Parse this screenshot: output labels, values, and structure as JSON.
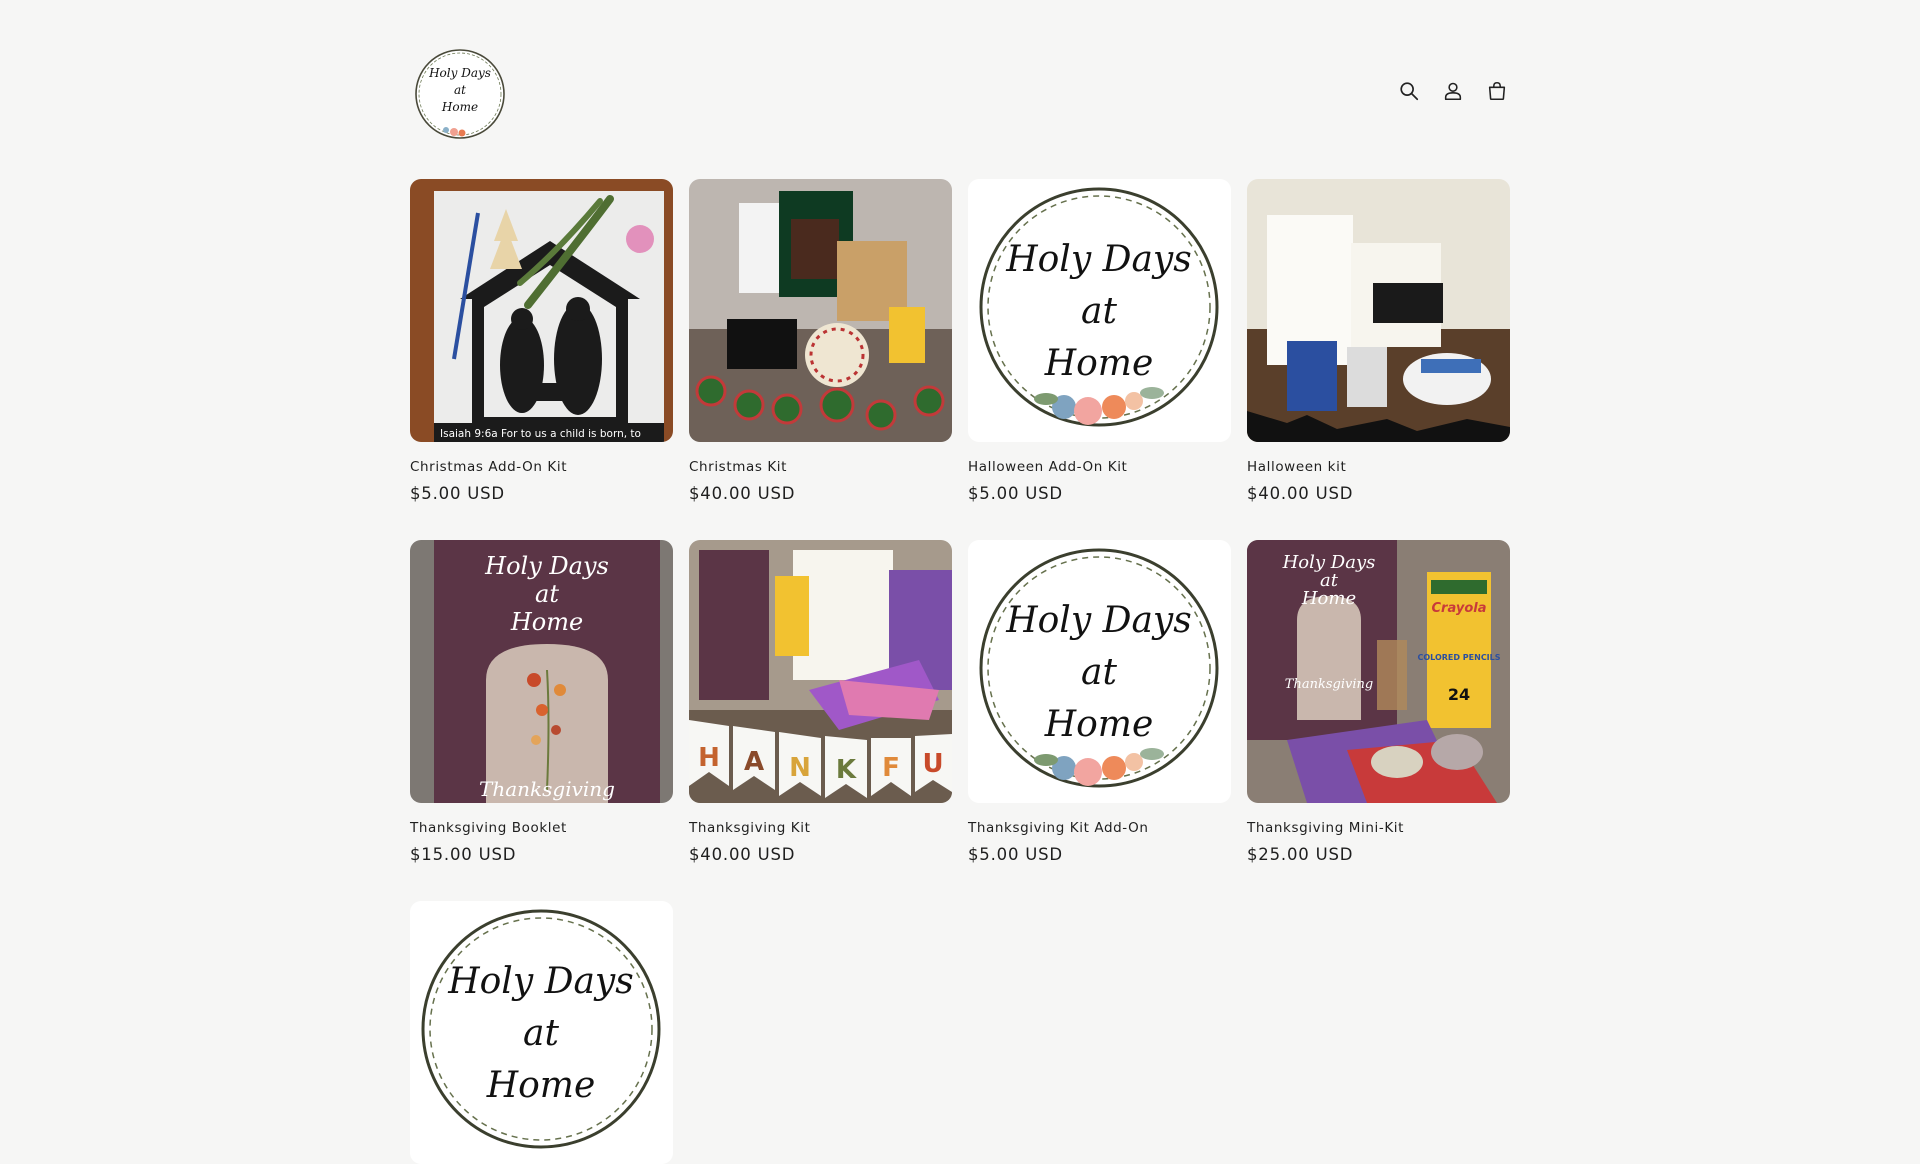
{
  "header": {
    "logo_text": [
      "Holy Days",
      "at",
      "Home"
    ]
  },
  "products": [
    {
      "title": "Christmas Add-On Kit",
      "price": "$5.00 USD",
      "image": "christmas-nativity"
    },
    {
      "title": "Christmas Kit",
      "price": "$40.00 USD",
      "image": "christmas-kit"
    },
    {
      "title": "Halloween Add-On Kit",
      "price": "$5.00 USD",
      "image": "logo-wreath"
    },
    {
      "title": "Halloween kit",
      "price": "$40.00 USD",
      "image": "halloween-kit"
    },
    {
      "title": "Thanksgiving Booklet",
      "price": "$15.00 USD",
      "image": "thanksgiving-booklet"
    },
    {
      "title": "Thanksgiving Kit",
      "price": "$40.00 USD",
      "image": "thanksgiving-kit"
    },
    {
      "title": "Thanksgiving Kit Add-On",
      "price": "$5.00 USD",
      "image": "logo-wreath"
    },
    {
      "title": "Thanksgiving Mini-Kit",
      "price": "$25.00 USD",
      "image": "thanksgiving-mini"
    },
    {
      "title": "",
      "price": "",
      "image": "logo-wreath"
    }
  ],
  "image_text": {
    "nativity_caption": "Isaiah 9:6a For to us a child is born, to",
    "wreath": [
      "Holy Days",
      "at",
      "Home"
    ],
    "booklet": [
      "Holy Days",
      "at",
      "Home",
      "Thanksgiving"
    ],
    "banner_letters": [
      "H",
      "A",
      "N",
      "K",
      "F",
      "U"
    ],
    "pencils_brand": "Crayola",
    "pencils_label": "COLORED PENCILS",
    "pencils_count": "24"
  },
  "icons": [
    "search-icon",
    "account-icon",
    "cart-icon"
  ]
}
